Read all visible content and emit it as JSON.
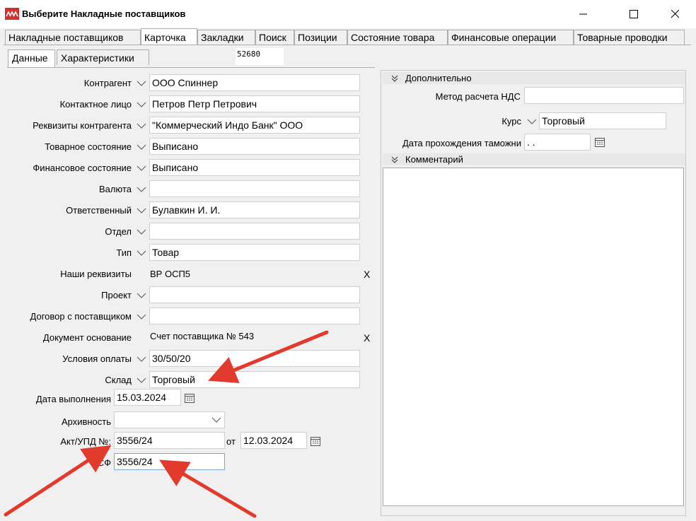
{
  "window": {
    "title": "Выберите Накладные поставщиков"
  },
  "tabs": [
    "Накладные поставщиков",
    "Карточка",
    "Закладки",
    "Поиск",
    "Позиции",
    "Состояние товара",
    "Финансовые операции",
    "Товарные проводки"
  ],
  "subtabs": [
    "Данные",
    "Характеристики"
  ],
  "doc_number": "52680",
  "form": {
    "kontragent": {
      "label": "Контрагент",
      "value": "ООО Спиннер"
    },
    "contact": {
      "label": "Контактное лицо",
      "value": "Петров Петр Петрович"
    },
    "requisites": {
      "label": "Реквизиты контрагента",
      "value": "\"Коммерческий Индо Банк\" ООО"
    },
    "goods_state": {
      "label": "Товарное состояние",
      "value": "Выписано"
    },
    "fin_state": {
      "label": "Финансовое состояние",
      "value": "Выписано"
    },
    "currency": {
      "label": "Валюта",
      "value": ""
    },
    "responsible": {
      "label": "Ответственный",
      "value": "Булавкин И. И."
    },
    "department": {
      "label": "Отдел",
      "value": ""
    },
    "type": {
      "label": "Тип",
      "value": "Товар"
    },
    "our_requisites": {
      "label": "Наши реквизиты",
      "value": "ВР ОСП5",
      "clear": "X"
    },
    "project": {
      "label": "Проект",
      "value": ""
    },
    "contract": {
      "label": "Договор с поставщиком",
      "value": ""
    },
    "base_doc": {
      "label": "Документ основание",
      "value": "Счет поставщика № 543",
      "clear": "X"
    },
    "payment_terms": {
      "label": "Условия оплаты",
      "value": "30/50/20"
    },
    "warehouse": {
      "label": "Склад",
      "value": "Торговый"
    },
    "exec_date": {
      "label": "Дата выполнения",
      "value": "15.03.2024"
    },
    "archive": {
      "label": "Архивность",
      "value": ""
    },
    "act": {
      "label": "Акт/УПД №:",
      "value": "3556/24",
      "from_label": "от",
      "date": "12.03.2024"
    },
    "sf": {
      "label": "СФ",
      "value": "3556/24"
    }
  },
  "additional": {
    "header": "Дополнительно",
    "vat_method": {
      "label": "Метод расчета НДС",
      "value": ""
    },
    "rate": {
      "label": "Курс",
      "value": "Торговый"
    },
    "customs_date": {
      "label": "Дата прохождения таможни",
      "value": " .  ."
    }
  },
  "comment": {
    "header": "Комментарий",
    "value": ""
  },
  "colors": {
    "annotation_arrow": "#e23b2e",
    "focus_border": "#7aa7d6"
  }
}
